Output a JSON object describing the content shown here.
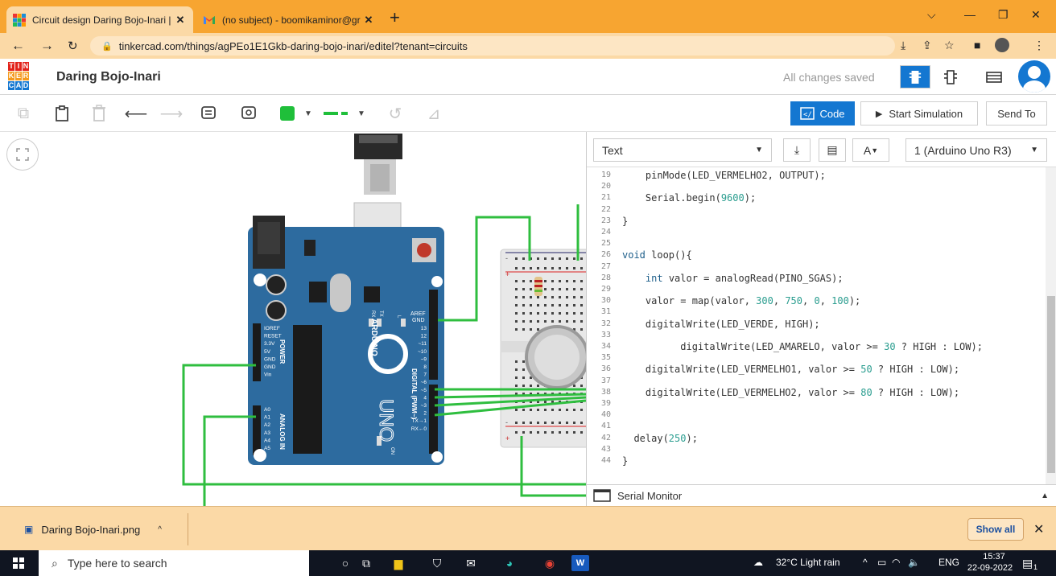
{
  "browser": {
    "tabs": [
      {
        "title": "Circuit design Daring Bojo-Inari |",
        "active": true
      },
      {
        "title": "(no subject) - boomikaminor@gr",
        "active": false
      }
    ],
    "url": "tinkercad.com/things/agPEo1E1Gkb-daring-bojo-inari/editel?tenant=circuits"
  },
  "header": {
    "logo_letters": [
      "T",
      "I",
      "N",
      "K",
      "E",
      "R",
      "C",
      "A",
      "D"
    ],
    "project_name": "Daring Bojo-Inari",
    "save_status": "All changes saved"
  },
  "toolbar": {
    "code_label": "Code",
    "start_simulation_label": "Start Simulation",
    "send_to_label": "Send To",
    "wire_color": "#1fbf3a"
  },
  "board": {
    "aref": "AREF",
    "gnd": "GND",
    "digital_pins": [
      "13",
      "12",
      "~11",
      "~10",
      "~9",
      "8",
      "7",
      "~6",
      "~5",
      "4",
      "~3",
      "2",
      "TX→1",
      "RX←0"
    ],
    "power_pins": [
      "IOREF",
      "RESET",
      "3.3V",
      "5V",
      "GND",
      "GND",
      "Vin"
    ],
    "analog_pins": [
      "A0",
      "A1",
      "A2",
      "A3",
      "A4",
      "A5"
    ],
    "power_label": "POWER",
    "analog_label": "ANALOG IN",
    "digital_label": "DIGITAL (PWM~)",
    "brand": "ARDUINO",
    "model": "UNO",
    "on_label": "ON",
    "l_label": "L",
    "tx_label": "TX",
    "rx_label": "RX"
  },
  "code_panel": {
    "mode": "Text",
    "device": "1 (Arduino Uno R3)",
    "serial_monitor_label": "Serial Monitor",
    "lines": [
      {
        "n": "19",
        "code": "    pinMode(LED_VERMELHO2, OUTPUT);"
      },
      {
        "n": "20",
        "code": ""
      },
      {
        "n": "21",
        "code": "    Serial.begin(9600);"
      },
      {
        "n": "22",
        "code": ""
      },
      {
        "n": "23",
        "code": "}"
      },
      {
        "n": "24",
        "code": ""
      },
      {
        "n": "25",
        "code": ""
      },
      {
        "n": "26",
        "code": "void loop(){"
      },
      {
        "n": "27",
        "code": ""
      },
      {
        "n": "28",
        "code": "    int valor = analogRead(PINO_SGAS);"
      },
      {
        "n": "29",
        "code": ""
      },
      {
        "n": "30",
        "code": "    valor = map(valor, 300, 750, 0, 100);"
      },
      {
        "n": "31",
        "code": ""
      },
      {
        "n": "32",
        "code": "    digitalWrite(LED_VERDE, HIGH);"
      },
      {
        "n": "33",
        "code": ""
      },
      {
        "n": "34",
        "code": "          digitalWrite(LED_AMARELO, valor >= 30 ? HIGH : LOW);"
      },
      {
        "n": "35",
        "code": ""
      },
      {
        "n": "36",
        "code": "    digitalWrite(LED_VERMELHO1, valor >= 50 ? HIGH : LOW);"
      },
      {
        "n": "37",
        "code": ""
      },
      {
        "n": "38",
        "code": "    digitalWrite(LED_VERMELHO2, valor >= 80 ? HIGH : LOW);"
      },
      {
        "n": "39",
        "code": ""
      },
      {
        "n": "40",
        "code": ""
      },
      {
        "n": "41",
        "code": ""
      },
      {
        "n": "42",
        "code": "  delay(250);"
      },
      {
        "n": "43",
        "code": ""
      },
      {
        "n": "44",
        "code": "}"
      }
    ]
  },
  "downloads": {
    "file": "Daring Bojo-Inari.png",
    "show_all": "Show all"
  },
  "taskbar": {
    "search_placeholder": "Type here to search",
    "weather": "32°C  Light rain",
    "lang": "ENG",
    "time": "15:37",
    "date": "22-09-2022",
    "notification_count": "1"
  }
}
